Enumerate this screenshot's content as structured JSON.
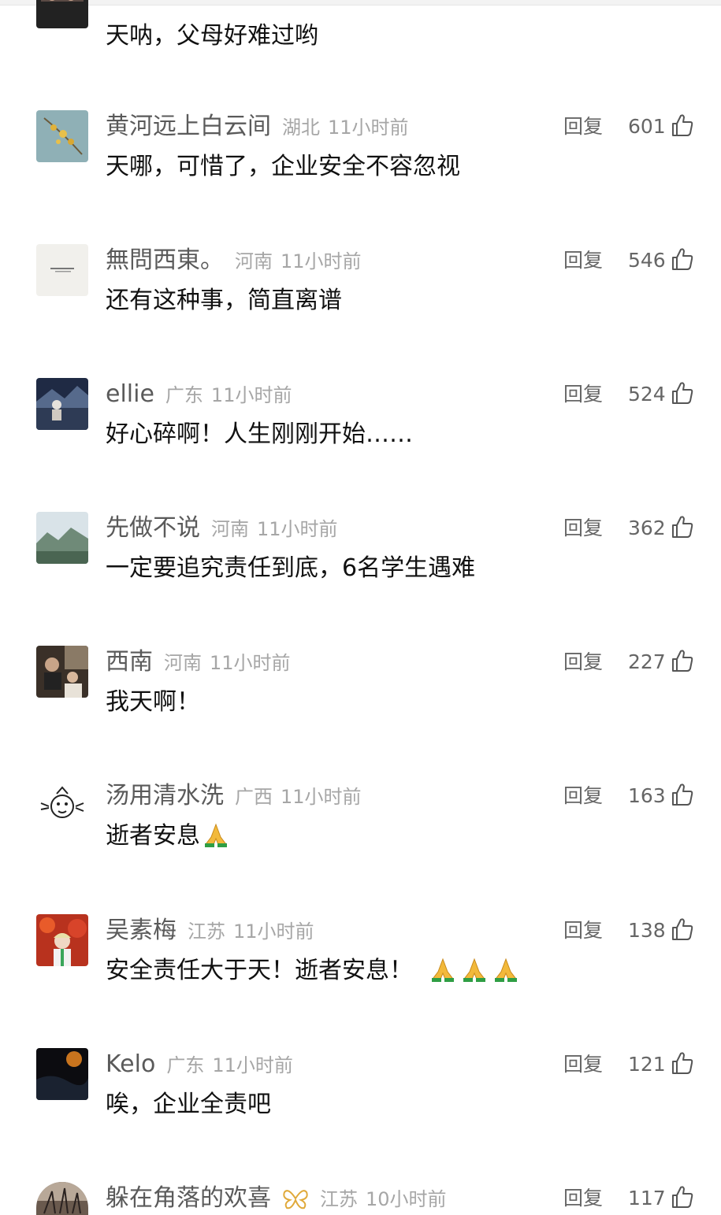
{
  "comments": [
    {
      "username": "",
      "region": "",
      "time": "",
      "reply": "",
      "likes": "",
      "text": "天呐，父母好难过哟"
    },
    {
      "username": "黄河远上白云间",
      "region": "湖北",
      "time": "11小时前",
      "reply": "回复",
      "likes": "601",
      "text": "天哪，可惜了，企业安全不容忽视"
    },
    {
      "username": "無問西東。",
      "region": "河南",
      "time": "11小时前",
      "reply": "回复",
      "likes": "546",
      "text": "还有这种事，简直离谱"
    },
    {
      "username": "ellie",
      "region": "广东",
      "time": "11小时前",
      "reply": "回复",
      "likes": "524",
      "text": "好心碎啊！人生刚刚开始……"
    },
    {
      "username": "先做不说",
      "region": "河南",
      "time": "11小时前",
      "reply": "回复",
      "likes": "362",
      "text": "一定要追究责任到底，6名学生遇难"
    },
    {
      "username": "西南",
      "region": "河南",
      "time": "11小时前",
      "reply": "回复",
      "likes": "227",
      "text": "我天啊！"
    },
    {
      "username": "汤用清水洗",
      "region": "广西",
      "time": "11小时前",
      "reply": "回复",
      "likes": "163",
      "text": "逝者安息"
    },
    {
      "username": "吴素梅",
      "region": "江苏",
      "time": "11小时前",
      "reply": "回复",
      "likes": "138",
      "text": "安全责任大于天！逝者安息！"
    },
    {
      "username": "Kelo",
      "region": "广东",
      "time": "11小时前",
      "reply": "回复",
      "likes": "121",
      "text": "唉，企业全责吧"
    },
    {
      "username": "躲在角落的欢喜",
      "region": "江苏",
      "time": "10小时前",
      "reply": "回复",
      "likes": "117",
      "text": ""
    }
  ],
  "icons": {
    "like": "thumbs-up-outline-icon",
    "pray": "folded-hands-emoji",
    "badge": "butterfly-badge-icon"
  },
  "colors": {
    "username": "#5a5a5a",
    "meta": "#a6a6a6",
    "content": "#111111",
    "action": "#666666"
  }
}
